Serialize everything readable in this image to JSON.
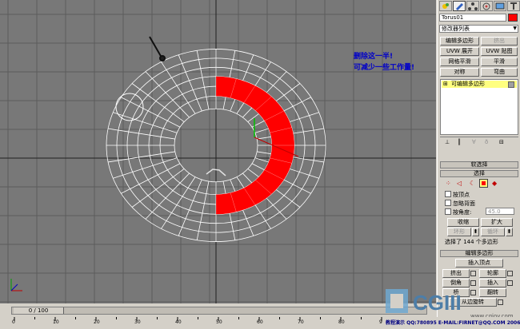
{
  "viewport": {
    "note_line1": "删除这一半!",
    "note_line2": "可减少一些工作量!"
  },
  "panel": {
    "object_name": "Torus01",
    "modifier_list": "修改器列表",
    "buttons": [
      "编辑多边形",
      "挤出",
      "UVW 展开",
      "UVW 贴图",
      "网格平滑",
      "平滑",
      "对称",
      "弯曲"
    ],
    "stack_item": "可编辑多边形",
    "soft_select": "软选择",
    "selection": "选择",
    "by_vertex": "按顶点",
    "ignore_backface": "忽略背面",
    "by_angle": "按角度:",
    "angle_value": "45.0",
    "shrink": "收缩",
    "grow": "扩大",
    "ring": "环形",
    "loop": "循环",
    "selection_status": "选择了 144 个多边形",
    "edit_poly": "编辑多边形",
    "insert_vertex": "插入顶点",
    "extrude": "挤出",
    "outline": "轮廓",
    "bevel": "倒角",
    "inset": "插入",
    "bridge": "桥",
    "flip": "翻转",
    "hinge": "从边旋转"
  },
  "timeline": {
    "frame_readout": "0 / 100",
    "ticks": [
      "0",
      "10",
      "20",
      "30",
      "40",
      "50",
      "60",
      "70",
      "80",
      "90",
      "100"
    ]
  },
  "footer": {
    "credit": "教程演示 QQ:780895 E-MAIL:FIRNET@QQ.COM 2006-8-25"
  },
  "watermark": {
    "logo": "CGIII",
    "url": "www.cgjoy.com"
  },
  "colors": {
    "viewport_bg": "#787878",
    "selection_red": "#ff0000",
    "note_blue": "#0000c8",
    "stack_highlight": "#ffff80"
  },
  "icons": [
    "create-icon",
    "modify-icon",
    "hierarchy-icon",
    "motion-icon",
    "display-icon",
    "utilities-icon"
  ]
}
